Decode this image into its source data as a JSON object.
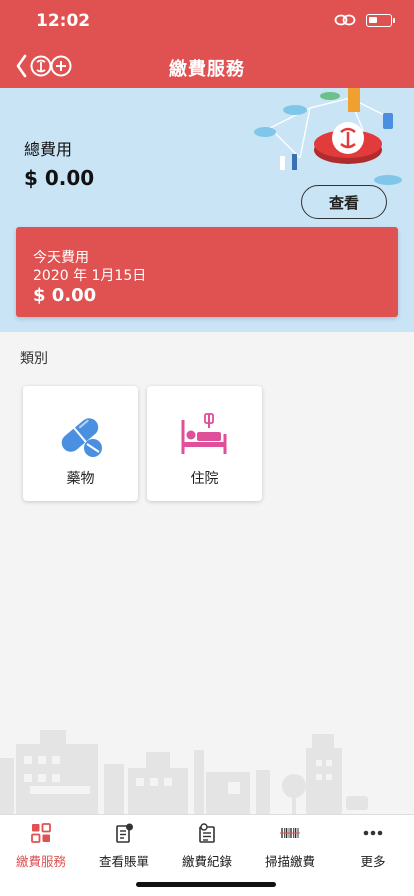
{
  "status": {
    "time": "12:02"
  },
  "nav": {
    "title": "繳費服務",
    "back_icon": "chevron-left-icon"
  },
  "summary": {
    "label": "總費用",
    "amount": "$ 0.00",
    "view_button": "查看"
  },
  "today": {
    "label": "今天費用",
    "date": "2020 年 1月15日",
    "amount": "$ 0.00"
  },
  "categories": {
    "title": "類別",
    "items": [
      {
        "label": "藥物",
        "icon": "pill-icon",
        "color": "#4a8fe0"
      },
      {
        "label": "住院",
        "icon": "hospital-bed-icon",
        "color": "#e04f9a"
      }
    ]
  },
  "tabs": [
    {
      "label": "繳費服務",
      "icon": "grid-icon",
      "active": true
    },
    {
      "label": "查看賬單",
      "icon": "bill-icon",
      "active": false
    },
    {
      "label": "繳費紀錄",
      "icon": "record-icon",
      "active": false
    },
    {
      "label": "掃描繳費",
      "icon": "barcode-icon",
      "active": false
    },
    {
      "label": "更多",
      "icon": "more-icon",
      "active": false
    }
  ],
  "colors": {
    "brand": "#e05252",
    "hero_bg": "#c8e4f5"
  }
}
